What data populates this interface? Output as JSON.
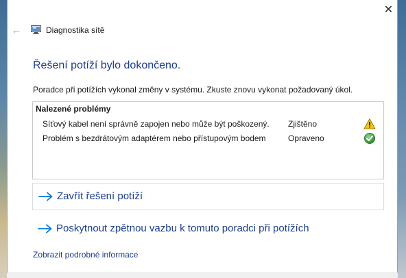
{
  "window": {
    "title": "Diagnostika sítě",
    "close_glyph": "✕",
    "back_glyph": "←"
  },
  "heading": "Řešení potíží bylo dokončeno.",
  "description": "Poradce při potížích vykonal změny v systému. Zkuste znovu vykonat požadovaný úkol.",
  "problems": {
    "title": "Nalezené problémy",
    "items": [
      {
        "text": "Síťový kabel není správně zapojen nebo může být poškozený.",
        "status": "Zjištěno",
        "icon": "warning-icon"
      },
      {
        "text": "Problém s bezdrátovým adaptérem nebo přístupovým bodem",
        "status": "Opraveno",
        "icon": "check-icon"
      }
    ]
  },
  "actions": {
    "close_label": "Zavřít řešení potíží",
    "feedback_label": "Poskytnout zpětnou vazbu k tomuto poradci při potížích"
  },
  "details_link": "Zobrazit podrobné informace",
  "colors": {
    "link": "#1c3d8c",
    "accent": "#0078d7",
    "warning": "#f2c40c",
    "success": "#3c9a3c"
  }
}
